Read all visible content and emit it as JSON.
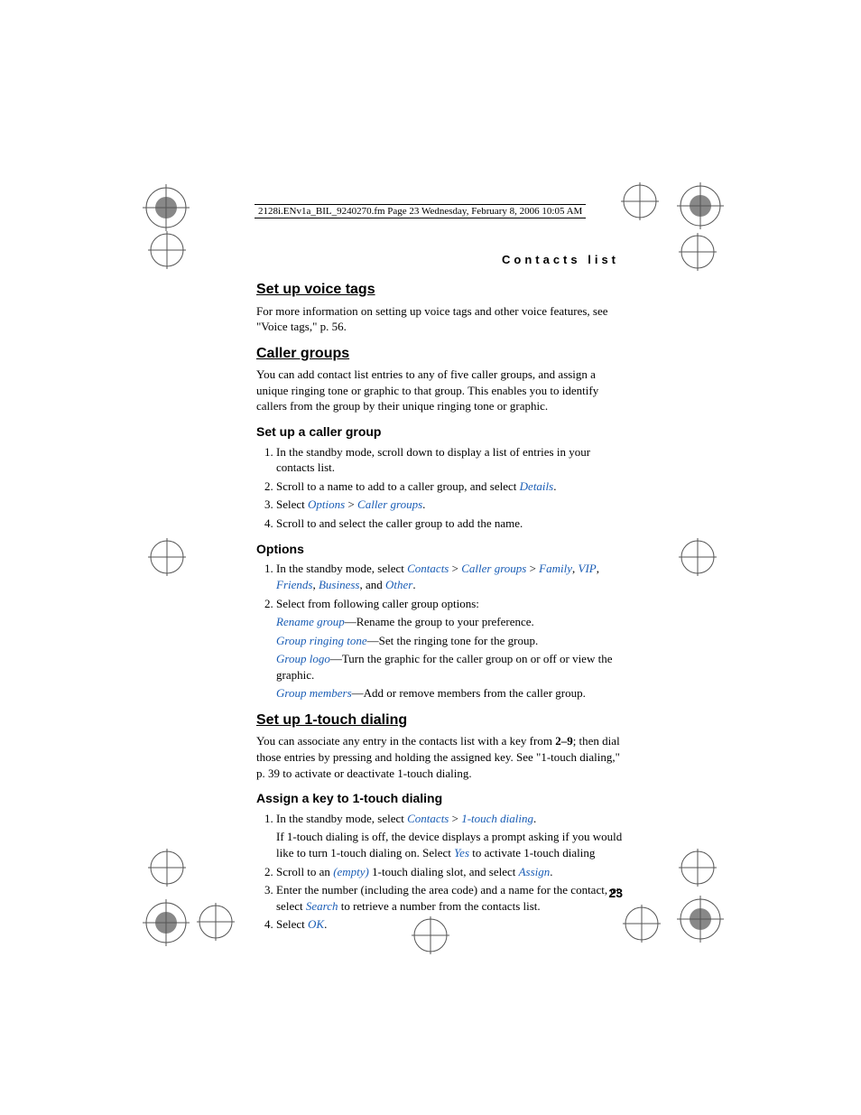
{
  "header": "2128i.ENv1a_BIL_9240270.fm  Page 23  Wednesday, February 8, 2006  10:05 AM",
  "chapter": "Contacts list",
  "s1": {
    "h": "Set up voice tags",
    "p": "For more information on setting up voice tags and other voice features, see \"Voice tags,\" p. 56."
  },
  "s2": {
    "h": "Caller groups",
    "p": "You can add contact list entries to any of five caller groups, and assign a unique ringing tone or graphic to that group. This enables you to identify callers from the group by their unique ringing tone or graphic.",
    "sub1": {
      "h": "Set up a caller group",
      "l1": "In the standby mode, scroll down to display a list of entries in your contacts list.",
      "l2a": "Scroll to a name to add to a caller group, and select ",
      "l2b": "Details",
      "l2c": ".",
      "l3a": "Select ",
      "l3b": "Options",
      "l3c": " > ",
      "l3d": "Caller groups",
      "l3e": ".",
      "l4": "Scroll to and select the caller group to add the name."
    },
    "sub2": {
      "h": "Options",
      "l1a": "In the standby mode, select ",
      "l1b": "Contacts",
      "l1c": " > ",
      "l1d": "Caller groups",
      "l1e": " > ",
      "l1f": "Family",
      "l1g": ", ",
      "l1h": "VIP",
      "l1i": ", ",
      "l1j": "Friends",
      "l1k": ", ",
      "l1l": "Business",
      "l1m": ", and ",
      "l1n": "Other",
      "l1o": ".",
      "l2": "Select from following caller group options:",
      "d1a": "Rename group",
      "d1b": "—Rename the group to your preference.",
      "d2a": "Group ringing tone",
      "d2b": "—Set the ringing tone for the group.",
      "d3a": "Group logo",
      "d3b": "—Turn the graphic for the caller group on or off or view the graphic.",
      "d4a": "Group members",
      "d4b": "—Add or remove members from the caller group."
    }
  },
  "s3": {
    "h": "Set up 1-touch dialing",
    "pa": "You can associate any entry in the contacts list with a key from ",
    "pb": "2–9",
    "pc": "; then dial those entries by pressing and holding the assigned key. See \"1-touch dialing,\" p. 39 to activate or deactivate 1-touch dialing.",
    "sub1": {
      "h": "Assign a key to 1-touch dialing",
      "l1a": "In the standby mode, select ",
      "l1b": "Contacts",
      "l1c": " > ",
      "l1d": "1-touch dialing",
      "l1e": ".",
      "l1pa": "If 1-touch dialing is off, the device displays a prompt asking if you would like to turn 1-touch dialing on. Select ",
      "l1pb": "Yes",
      "l1pc": " to activate 1-touch dialing",
      "l2a": "Scroll to an ",
      "l2b": "(empty)",
      "l2c": " 1-touch dialing slot, and select ",
      "l2d": "Assign",
      "l2e": ".",
      "l3a": "Enter the number (including the area code) and a name for the contact, or select ",
      "l3b": "Search",
      "l3c": " to retrieve a number from the contacts list.",
      "l4a": "Select ",
      "l4b": "OK",
      "l4c": "."
    }
  },
  "pagenum": "23"
}
